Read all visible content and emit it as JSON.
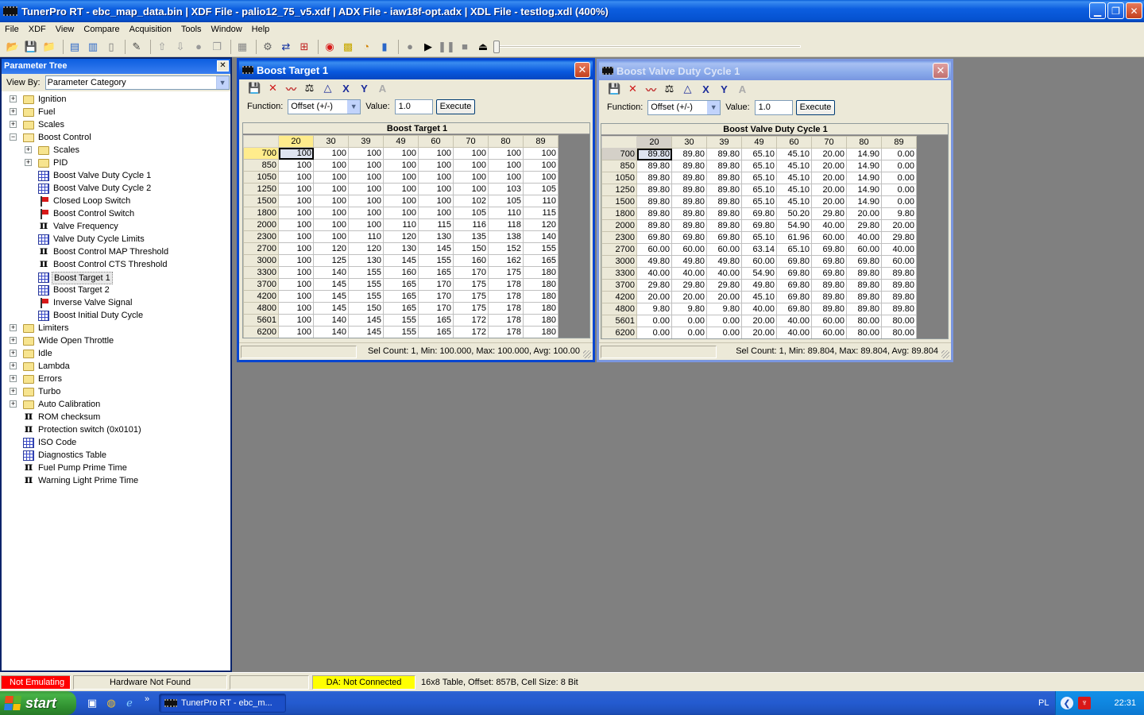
{
  "app": {
    "title": "TunerPro RT - ebc_map_data.bin | XDF File - palio12_75_v5.xdf | ADX File - iaw18f-opt.adx | XDL File - testlog.xdl (400%)"
  },
  "menu": [
    "File",
    "XDF",
    "View",
    "Compare",
    "Acquisition",
    "Tools",
    "Window",
    "Help"
  ],
  "param_tree": {
    "title": "Parameter Tree",
    "view_by_label": "View By:",
    "view_by_value": "Parameter Category",
    "items": [
      {
        "label": "Ignition",
        "level": 0,
        "icon": "folder-icon",
        "expander": "+"
      },
      {
        "label": "Fuel",
        "level": 0,
        "icon": "folder-icon",
        "expander": "+"
      },
      {
        "label": "Scales",
        "level": 0,
        "icon": "folder-icon",
        "expander": "+"
      },
      {
        "label": "Boost Control",
        "level": 0,
        "icon": "folder-open-icon",
        "expander": "-"
      },
      {
        "label": "Scales",
        "level": 1,
        "icon": "folder-icon",
        "expander": "+"
      },
      {
        "label": "PID",
        "level": 1,
        "icon": "folder-icon",
        "expander": "+"
      },
      {
        "label": "Boost Valve Duty Cycle 1",
        "level": 1,
        "icon": "table-icon"
      },
      {
        "label": "Boost Valve Duty Cycle 2",
        "level": 1,
        "icon": "table-icon"
      },
      {
        "label": "Closed Loop Switch",
        "level": 1,
        "icon": "flag-icon"
      },
      {
        "label": "Boost Control Switch",
        "level": 1,
        "icon": "flag-icon"
      },
      {
        "label": "Valve Frequency",
        "level": 1,
        "icon": "pi-icon"
      },
      {
        "label": "Valve Duty Cycle Limits",
        "level": 1,
        "icon": "table-icon"
      },
      {
        "label": "Boost Control MAP Threshold",
        "level": 1,
        "icon": "pi-icon"
      },
      {
        "label": "Boost Control CTS Threshold",
        "level": 1,
        "icon": "pi-icon"
      },
      {
        "label": "Boost Target 1",
        "level": 1,
        "icon": "table-icon",
        "selected": true
      },
      {
        "label": "Boost Target 2",
        "level": 1,
        "icon": "table-icon"
      },
      {
        "label": "Inverse Valve Signal",
        "level": 1,
        "icon": "flag-icon"
      },
      {
        "label": "Boost Initial Duty Cycle",
        "level": 1,
        "icon": "table-icon"
      },
      {
        "label": "Limiters",
        "level": 0,
        "icon": "folder-icon",
        "expander": "+"
      },
      {
        "label": "Wide Open Throttle",
        "level": 0,
        "icon": "folder-icon",
        "expander": "+"
      },
      {
        "label": "Idle",
        "level": 0,
        "icon": "folder-icon",
        "expander": "+"
      },
      {
        "label": "Lambda",
        "level": 0,
        "icon": "folder-icon",
        "expander": "+"
      },
      {
        "label": "Errors",
        "level": 0,
        "icon": "folder-icon",
        "expander": "+"
      },
      {
        "label": "Turbo",
        "level": 0,
        "icon": "folder-icon",
        "expander": "+"
      },
      {
        "label": "Auto Calibration",
        "level": 0,
        "icon": "folder-icon",
        "expander": "+"
      },
      {
        "label": "ROM checksum",
        "level": 0,
        "icon": "pi-icon"
      },
      {
        "label": "Protection switch (0x0101)",
        "level": 0,
        "icon": "pi-icon"
      },
      {
        "label": "ISO Code",
        "level": 0,
        "icon": "table-icon"
      },
      {
        "label": "Diagnostics Table",
        "level": 0,
        "icon": "table-icon"
      },
      {
        "label": "Fuel Pump Prime Time",
        "level": 0,
        "icon": "pi-icon"
      },
      {
        "label": "Warning Light Prime Time",
        "level": 0,
        "icon": "pi-icon"
      }
    ]
  },
  "windows": [
    {
      "id": "boost-target-1",
      "title": "Boost Target 1",
      "active": true,
      "function_label": "Function:",
      "function_value": "Offset (+/-)",
      "value_label": "Value:",
      "value": "1.0",
      "execute_label": "Execute",
      "table_header": "Boost Target 1",
      "columns": [
        "20",
        "30",
        "39",
        "49",
        "60",
        "70",
        "80",
        "89"
      ],
      "rows": [
        "700",
        "850",
        "1050",
        "1250",
        "1500",
        "1800",
        "2000",
        "2300",
        "2700",
        "3000",
        "3300",
        "3700",
        "4200",
        "4800",
        "5601",
        "6200"
      ],
      "cells": [
        [
          "100",
          "100",
          "100",
          "100",
          "100",
          "100",
          "100",
          "100"
        ],
        [
          "100",
          "100",
          "100",
          "100",
          "100",
          "100",
          "100",
          "100"
        ],
        [
          "100",
          "100",
          "100",
          "100",
          "100",
          "100",
          "100",
          "100"
        ],
        [
          "100",
          "100",
          "100",
          "100",
          "100",
          "100",
          "103",
          "105"
        ],
        [
          "100",
          "100",
          "100",
          "100",
          "100",
          "102",
          "105",
          "110"
        ],
        [
          "100",
          "100",
          "100",
          "100",
          "100",
          "105",
          "110",
          "115"
        ],
        [
          "100",
          "100",
          "100",
          "110",
          "115",
          "116",
          "118",
          "120"
        ],
        [
          "100",
          "100",
          "110",
          "120",
          "130",
          "135",
          "138",
          "140"
        ],
        [
          "100",
          "120",
          "120",
          "130",
          "145",
          "150",
          "152",
          "155"
        ],
        [
          "100",
          "125",
          "130",
          "145",
          "155",
          "160",
          "162",
          "165"
        ],
        [
          "100",
          "140",
          "155",
          "160",
          "165",
          "170",
          "175",
          "180"
        ],
        [
          "100",
          "145",
          "155",
          "165",
          "170",
          "175",
          "178",
          "180"
        ],
        [
          "100",
          "145",
          "155",
          "165",
          "170",
          "175",
          "178",
          "180"
        ],
        [
          "100",
          "145",
          "150",
          "165",
          "170",
          "175",
          "178",
          "180"
        ],
        [
          "100",
          "140",
          "145",
          "155",
          "165",
          "172",
          "178",
          "180"
        ],
        [
          "100",
          "140",
          "145",
          "155",
          "165",
          "172",
          "178",
          "180"
        ]
      ],
      "status": "Sel Count: 1, Min: 100.000, Max: 100.000, Avg: 100.00"
    },
    {
      "id": "boost-valve-duty-cycle-1",
      "title": "Boost Valve Duty Cycle 1",
      "active": false,
      "function_label": "Function:",
      "function_value": "Offset (+/-)",
      "value_label": "Value:",
      "value": "1.0",
      "execute_label": "Execute",
      "table_header": "Boost Valve Duty Cycle 1",
      "columns": [
        "20",
        "30",
        "39",
        "49",
        "60",
        "70",
        "80",
        "89"
      ],
      "rows": [
        "700",
        "850",
        "1050",
        "1250",
        "1500",
        "1800",
        "2000",
        "2300",
        "2700",
        "3000",
        "3300",
        "3700",
        "4200",
        "4800",
        "5601",
        "6200"
      ],
      "cells": [
        [
          "89.80",
          "89.80",
          "89.80",
          "65.10",
          "45.10",
          "20.00",
          "14.90",
          "0.00"
        ],
        [
          "89.80",
          "89.80",
          "89.80",
          "65.10",
          "45.10",
          "20.00",
          "14.90",
          "0.00"
        ],
        [
          "89.80",
          "89.80",
          "89.80",
          "65.10",
          "45.10",
          "20.00",
          "14.90",
          "0.00"
        ],
        [
          "89.80",
          "89.80",
          "89.80",
          "65.10",
          "45.10",
          "20.00",
          "14.90",
          "0.00"
        ],
        [
          "89.80",
          "89.80",
          "89.80",
          "65.10",
          "45.10",
          "20.00",
          "14.90",
          "0.00"
        ],
        [
          "89.80",
          "89.80",
          "89.80",
          "69.80",
          "50.20",
          "29.80",
          "20.00",
          "9.80"
        ],
        [
          "89.80",
          "89.80",
          "89.80",
          "69.80",
          "54.90",
          "40.00",
          "29.80",
          "20.00"
        ],
        [
          "69.80",
          "69.80",
          "69.80",
          "65.10",
          "61.96",
          "60.00",
          "40.00",
          "29.80"
        ],
        [
          "60.00",
          "60.00",
          "60.00",
          "63.14",
          "65.10",
          "69.80",
          "60.00",
          "40.00"
        ],
        [
          "49.80",
          "49.80",
          "49.80",
          "60.00",
          "69.80",
          "69.80",
          "69.80",
          "60.00"
        ],
        [
          "40.00",
          "40.00",
          "40.00",
          "54.90",
          "69.80",
          "69.80",
          "89.80",
          "89.80"
        ],
        [
          "29.80",
          "29.80",
          "29.80",
          "49.80",
          "69.80",
          "89.80",
          "89.80",
          "89.80"
        ],
        [
          "20.00",
          "20.00",
          "20.00",
          "45.10",
          "69.80",
          "89.80",
          "89.80",
          "89.80"
        ],
        [
          "9.80",
          "9.80",
          "9.80",
          "40.00",
          "69.80",
          "89.80",
          "89.80",
          "89.80"
        ],
        [
          "0.00",
          "0.00",
          "0.00",
          "20.00",
          "40.00",
          "60.00",
          "80.00",
          "80.00"
        ],
        [
          "0.00",
          "0.00",
          "0.00",
          "20.00",
          "40.00",
          "60.00",
          "80.00",
          "80.00"
        ]
      ],
      "status": "Sel Count: 1, Min: 89.804, Max: 89.804, Avg: 89.804"
    }
  ],
  "statusbar": {
    "emulating": "Not Emulating",
    "hardware": "Hardware Not Found",
    "blank": "",
    "da": "DA: Not Connected",
    "info": "16x8 Table, Offset: 857B,  Cell Size: 8 Bit"
  },
  "taskbar": {
    "start": "start",
    "task_label": "TunerPro RT - ebc_m...",
    "lang": "PL",
    "clock": "22:31"
  },
  "colors": {
    "title_blue": "#0552d0",
    "highlight_yellow": "#ffec8c",
    "not_emulating_red": "#ff0000",
    "da_yellow": "#ffff00",
    "mdi_gray": "#808080"
  }
}
